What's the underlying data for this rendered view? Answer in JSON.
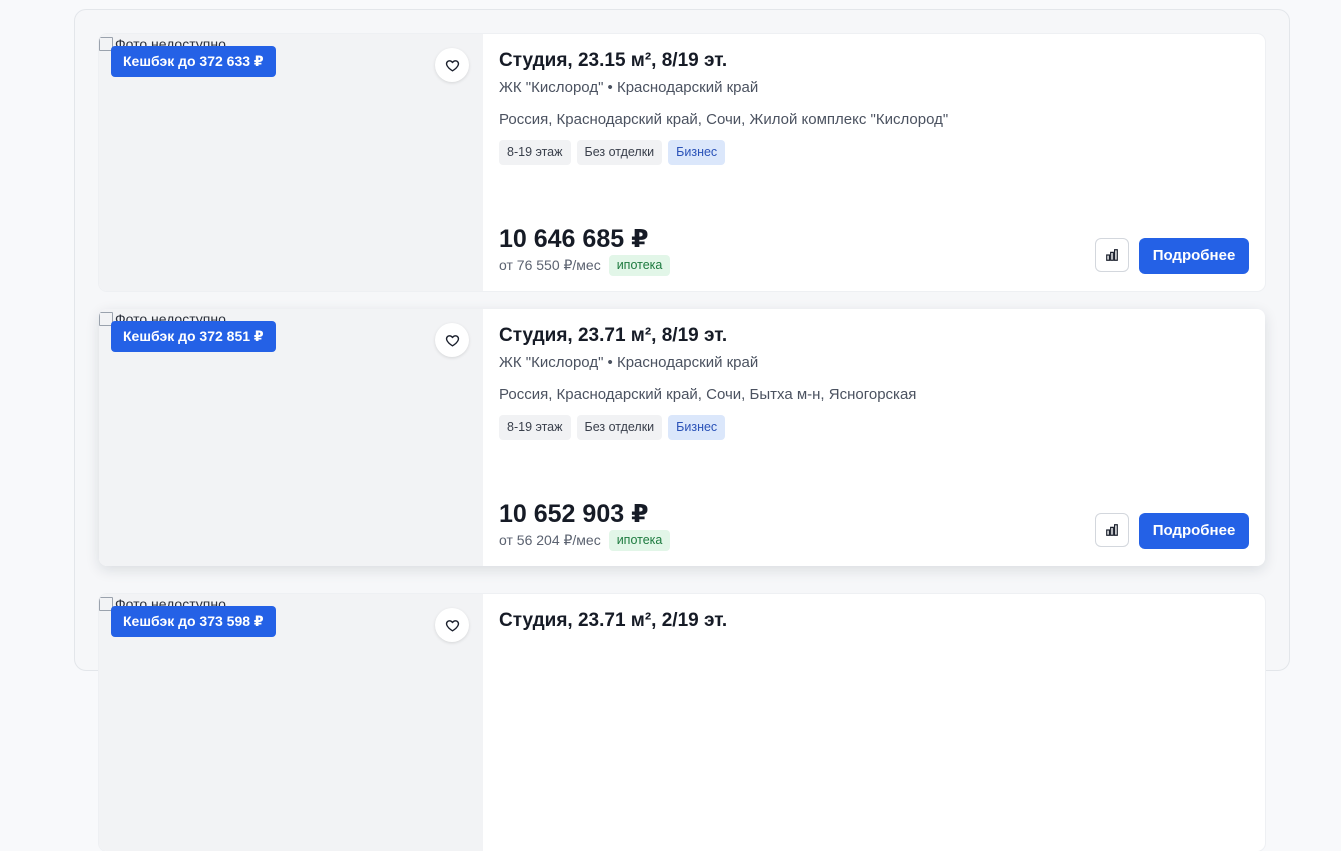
{
  "listings": [
    {
      "photo_alt": "Фото недоступно",
      "cashback": "Кешбэк до 372 633 ₽",
      "title": "Студия, 23.15 м², 8/19 эт.",
      "subtitle": "ЖК \"Кислород\" • Краснодарский край",
      "address": "Россия, Краснодарский край, Сочи, Жилой комплекс \"Кислород\"",
      "tags": [
        "8-19 этаж",
        "Без отделки",
        "Бизнес"
      ],
      "price": "10 646 685 ₽",
      "monthly": "от 76 550 ₽/мес",
      "mortgage_label": "ипотека",
      "details_label": "Подробнее"
    },
    {
      "photo_alt": "Фото недоступно",
      "cashback": "Кешбэк до 372 851 ₽",
      "title": "Студия, 23.71 м², 8/19 эт.",
      "subtitle": "ЖК \"Кислород\" • Краснодарский край",
      "address": "Россия, Краснодарский край, Сочи, Бытха м-н, Ясногорская",
      "tags": [
        "8-19 этаж",
        "Без отделки",
        "Бизнес"
      ],
      "price": "10 652 903 ₽",
      "monthly": "от 56 204 ₽/мес",
      "mortgage_label": "ипотека",
      "details_label": "Подробнее"
    },
    {
      "photo_alt": "Фото недоступно",
      "cashback": "Кешбэк до 373 598 ₽",
      "title": "Студия, 23.71 м², 2/19 эт."
    }
  ],
  "colors": {
    "accent": "#2461e6",
    "tag_business_bg": "#dbe7fb",
    "mortgage_bg": "#e2f6e8",
    "mortgage_text": "#1d7a3f"
  },
  "icons": {
    "favorite": "heart-icon",
    "compare": "bar-chart-icon",
    "broken_image": "broken-image-icon"
  }
}
